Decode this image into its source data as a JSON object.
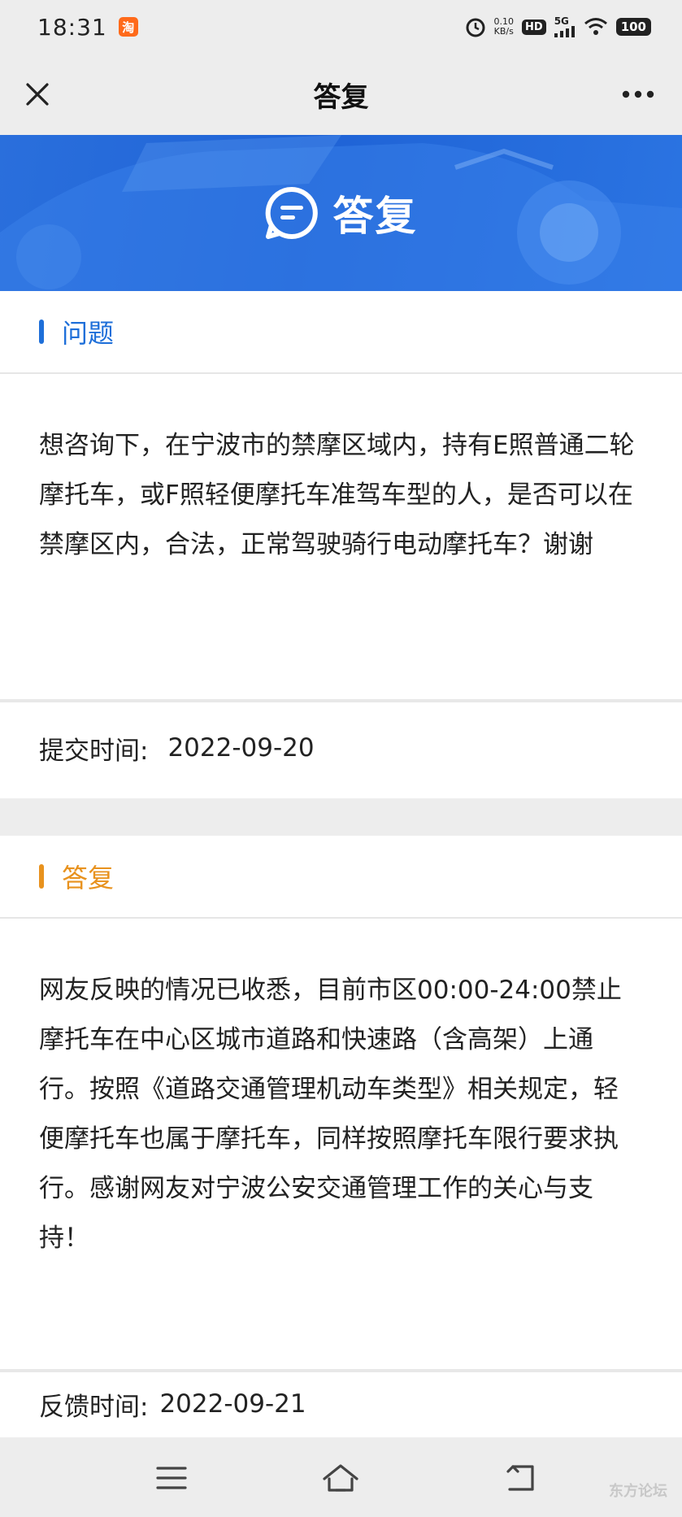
{
  "status_bar": {
    "time": "18:31",
    "app_badge": "淘",
    "net_speed_value": "0.10",
    "net_speed_unit": "KB/s",
    "hd_label": "HD",
    "network_label": "5G",
    "battery": "100"
  },
  "nav": {
    "title": "答复"
  },
  "banner": {
    "title": "答复"
  },
  "question": {
    "heading": "问题",
    "text": "想咨询下，在宁波市的禁摩区域内，持有E照普通二轮摩托车，或F照轻便摩托车准驾车型的人，是否可以在禁摩区内，合法，正常驾驶骑行电动摩托车？谢谢",
    "submit_label": "提交时间:",
    "submit_date": "2022-09-20"
  },
  "answer": {
    "heading": "答复",
    "text": "网友反映的情况已收悉，目前市区00:00-24:00禁止摩托车在中心区城市道路和快速路（含高架）上通行。按照《道路交通管理机动车类型》相关规定，轻便摩托车也属于摩托车，同样按照摩托车限行要求执行。感谢网友对宁波公安交通管理工作的关心与支持！",
    "feedback_label": "反馈时间:",
    "feedback_date": "2022-09-21"
  },
  "watermark": "东方论坛",
  "colors": {
    "question_accent": "#1e6fd9",
    "answer_accent": "#e8921e",
    "banner_blue": "#1f63d6"
  },
  "icons": [
    "close-icon",
    "more-icon",
    "alarm-icon",
    "wifi-icon",
    "signal-icon",
    "menu-icon",
    "home-icon",
    "back-icon"
  ]
}
